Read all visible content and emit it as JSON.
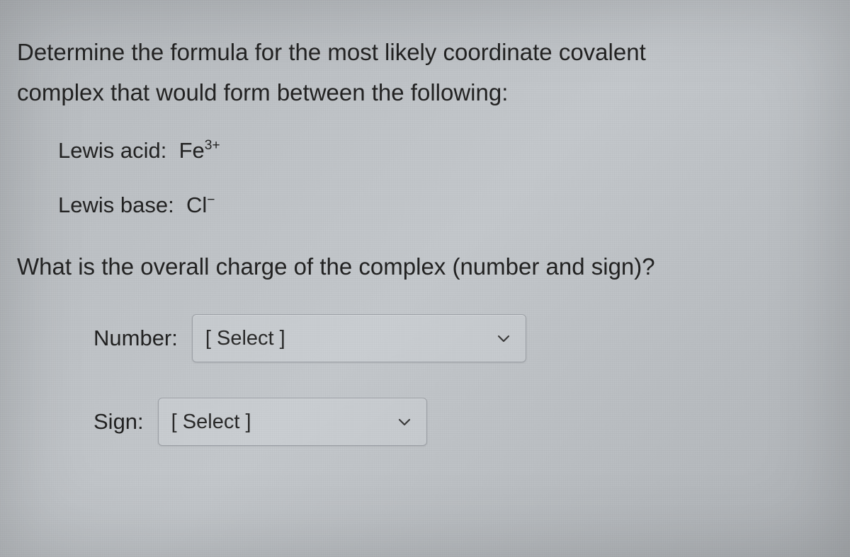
{
  "question": {
    "line1": "Determine the formula for the most likely coordinate covalent",
    "line2": "complex that would form between the following:"
  },
  "given": {
    "acid_label": "Lewis acid:",
    "acid_symbol": "Fe",
    "acid_super": "3+",
    "base_label": "Lewis base:",
    "base_symbol": "Cl",
    "base_super": "−"
  },
  "prompt2": "What is the overall charge of the complex (number and sign)?",
  "answers": {
    "number_label": "Number:",
    "number_placeholder": "[ Select ]",
    "sign_label": "Sign:",
    "sign_placeholder": "[ Select ]"
  }
}
